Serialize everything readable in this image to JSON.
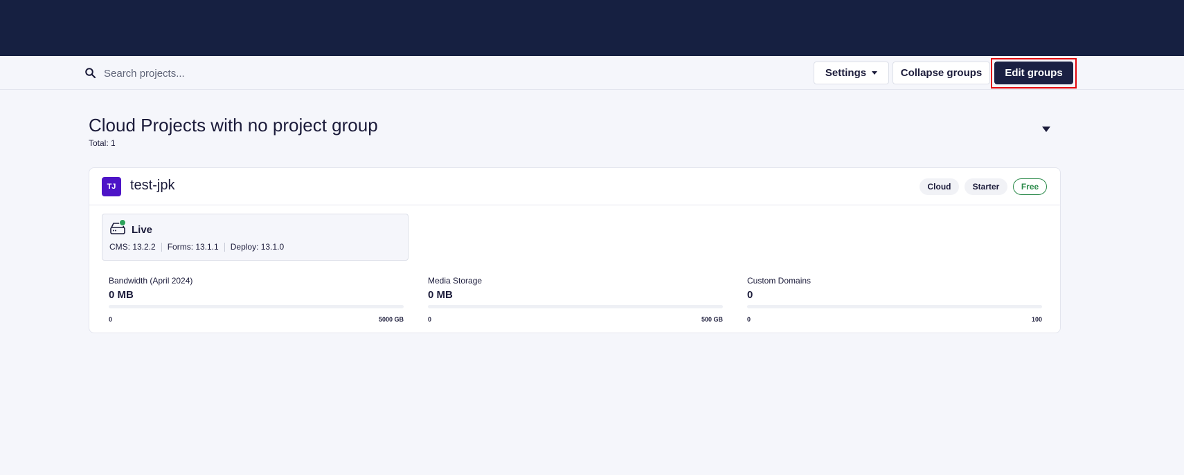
{
  "search": {
    "placeholder": "Search projects..."
  },
  "toolbar": {
    "settings_label": "Settings",
    "collapse_label": "Collapse groups",
    "edit_label": "Edit groups"
  },
  "group": {
    "title": "Cloud Projects with no project group",
    "total": "Total: 1"
  },
  "project": {
    "initials": "TJ",
    "name": "test-jpk",
    "tags": {
      "cloud": "Cloud",
      "starter": "Starter",
      "free": "Free"
    },
    "environment": {
      "name": "Live",
      "status_color": "#2ba15a",
      "cms": "CMS: 13.2.2",
      "forms": "Forms: 13.1.1",
      "deploy": "Deploy: 13.1.0"
    },
    "metrics": [
      {
        "label": "Bandwidth (April 2024)",
        "value": "0 MB",
        "min": "0",
        "max": "5000 GB",
        "fraction": 0
      },
      {
        "label": "Media Storage",
        "value": "0 MB",
        "min": "0",
        "max": "500 GB",
        "fraction": 0
      },
      {
        "label": "Custom Domains",
        "value": "0",
        "min": "0",
        "max": "100",
        "fraction": 0
      }
    ]
  },
  "colors": {
    "header_bg": "#162041",
    "primary_button": "#1b2043",
    "avatar": "#4d14c7",
    "free_tag": "#2b8a4a",
    "highlight": "#e3050c"
  }
}
